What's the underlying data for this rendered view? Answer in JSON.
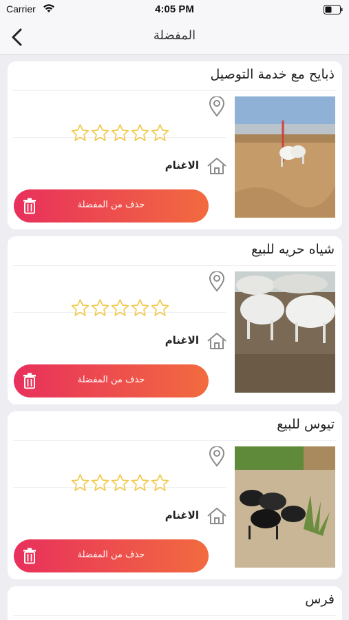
{
  "status_bar": {
    "carrier": "Carrier",
    "time": "4:05 PM"
  },
  "nav": {
    "title": "المفضلة",
    "back_icon": "chevron-left-icon"
  },
  "favorites": [
    {
      "title": "ذبايح مع خدمة التوصيل",
      "category": "الاغنام",
      "remove_label": "حذف من المفضلة",
      "rating": 0,
      "max_rating": 5
    },
    {
      "title": "شياه حريه للبيع",
      "category": "الاغنام",
      "remove_label": "حذف من المفضلة",
      "rating": 0,
      "max_rating": 5
    },
    {
      "title": "تيوس للبيع",
      "category": "الاغنام",
      "remove_label": "حذف من المفضلة",
      "rating": 0,
      "max_rating": 5
    },
    {
      "title": "فرس"
    }
  ],
  "colors": {
    "accent_start": "#e8305c",
    "accent_end": "#f26b3f",
    "star": "#f2c94c"
  }
}
